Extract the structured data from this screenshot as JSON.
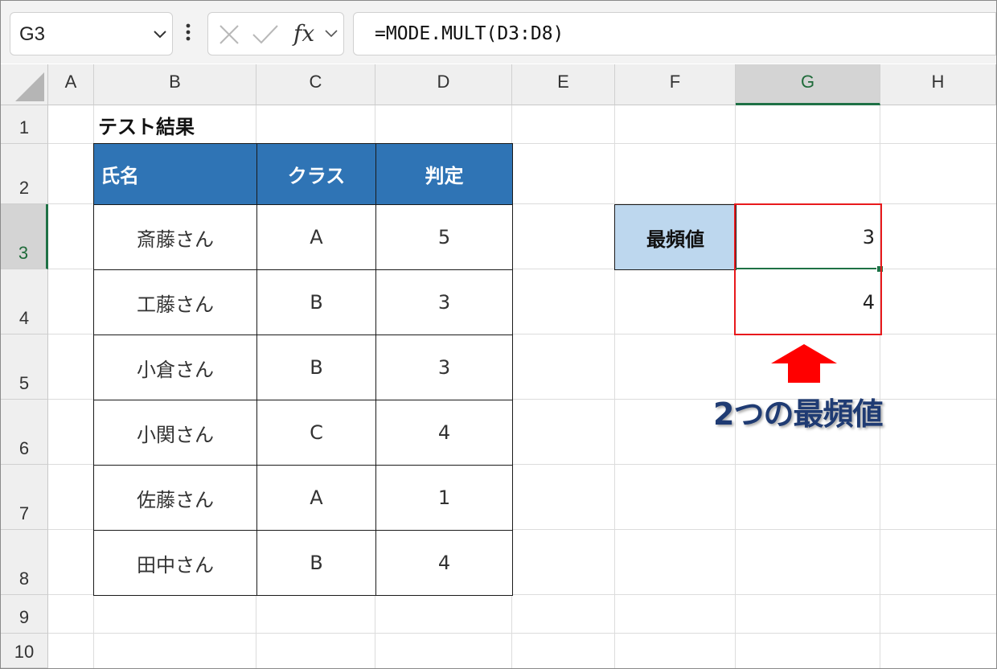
{
  "formula_bar": {
    "name_box": "G3",
    "fx_label": "fx",
    "formula": "=MODE.MULT(D3:D8)"
  },
  "columns": [
    "A",
    "B",
    "C",
    "D",
    "E",
    "F",
    "G",
    "H"
  ],
  "rows": [
    "1",
    "2",
    "3",
    "4",
    "5",
    "6",
    "7",
    "8",
    "9",
    "10"
  ],
  "selected_column": "G",
  "selected_row": "3",
  "sheet": {
    "title": "テスト結果",
    "headers": [
      "氏名",
      "クラス",
      "判定"
    ],
    "records": [
      {
        "name": "斎藤さん",
        "class": "A",
        "score": "5"
      },
      {
        "name": "工藤さん",
        "class": "B",
        "score": "3"
      },
      {
        "name": "小倉さん",
        "class": "B",
        "score": "3"
      },
      {
        "name": "小関さん",
        "class": "C",
        "score": "4"
      },
      {
        "name": "佐藤さん",
        "class": "A",
        "score": "1"
      },
      {
        "name": "田中さん",
        "class": "B",
        "score": "4"
      }
    ],
    "mode_label": "最頻値",
    "mode_values": [
      "3",
      "4"
    ]
  },
  "annotation": {
    "callout": "2つの最頻値",
    "highlight_color": "#e8191c",
    "callout_color": "#1f3b73"
  },
  "colors": {
    "header_fill": "#2f74b5",
    "label_fill": "#bdd7ee",
    "selection": "#1e7145"
  }
}
